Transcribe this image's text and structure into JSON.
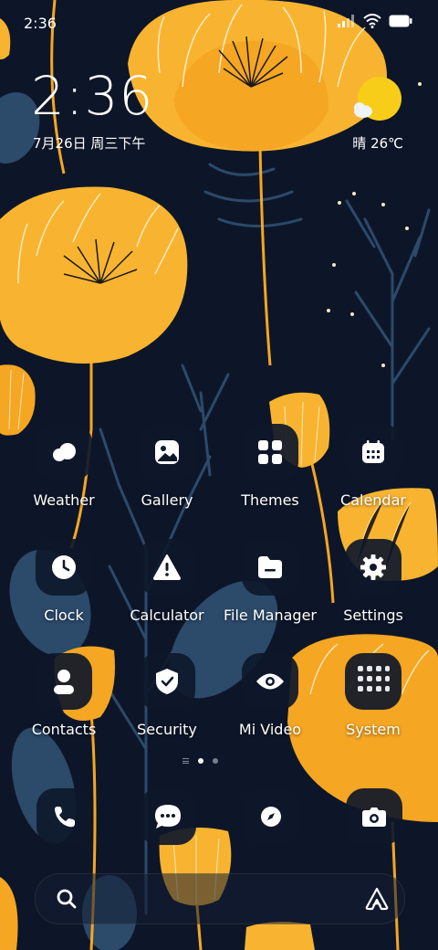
{
  "status_bar": {
    "time": "2:36"
  },
  "clock_widget": {
    "time": "2:36",
    "date": "7月26日 周三下午"
  },
  "weather_widget": {
    "condition_icon": "sun-cloud-icon",
    "text": "晴 26℃"
  },
  "apps": [
    {
      "label": "Weather",
      "icon": "weather-cloud-icon"
    },
    {
      "label": "Gallery",
      "icon": "gallery-icon"
    },
    {
      "label": "Themes",
      "icon": "themes-grid-icon"
    },
    {
      "label": "Calendar",
      "icon": "calendar-icon"
    },
    {
      "label": "Clock",
      "icon": "clock-icon"
    },
    {
      "label": "Calculator",
      "icon": "warning-triangle-icon"
    },
    {
      "label": "File Manager",
      "icon": "folder-icon"
    },
    {
      "label": "Settings",
      "icon": "gear-icon"
    },
    {
      "label": "Contacts",
      "icon": "contact-icon"
    },
    {
      "label": "Security",
      "icon": "shield-check-icon"
    },
    {
      "label": "Mi Video",
      "icon": "eye-icon"
    },
    {
      "label": "System",
      "icon": "folder-grid-icon"
    }
  ],
  "page_indicator": {
    "pages": 2,
    "active": 1
  },
  "dock": [
    {
      "icon": "phone-icon"
    },
    {
      "icon": "message-icon"
    },
    {
      "icon": "compass-icon"
    },
    {
      "icon": "camera-icon"
    }
  ],
  "search_bar": {
    "search_icon": "search-icon",
    "assistant_icon": "assistant-icon"
  },
  "colors": {
    "background": "#0d1628",
    "flower": "#f5a623",
    "flower_light": "#f8c24a",
    "leaf": "#2c4a6a",
    "sun": "#f7cd19"
  }
}
